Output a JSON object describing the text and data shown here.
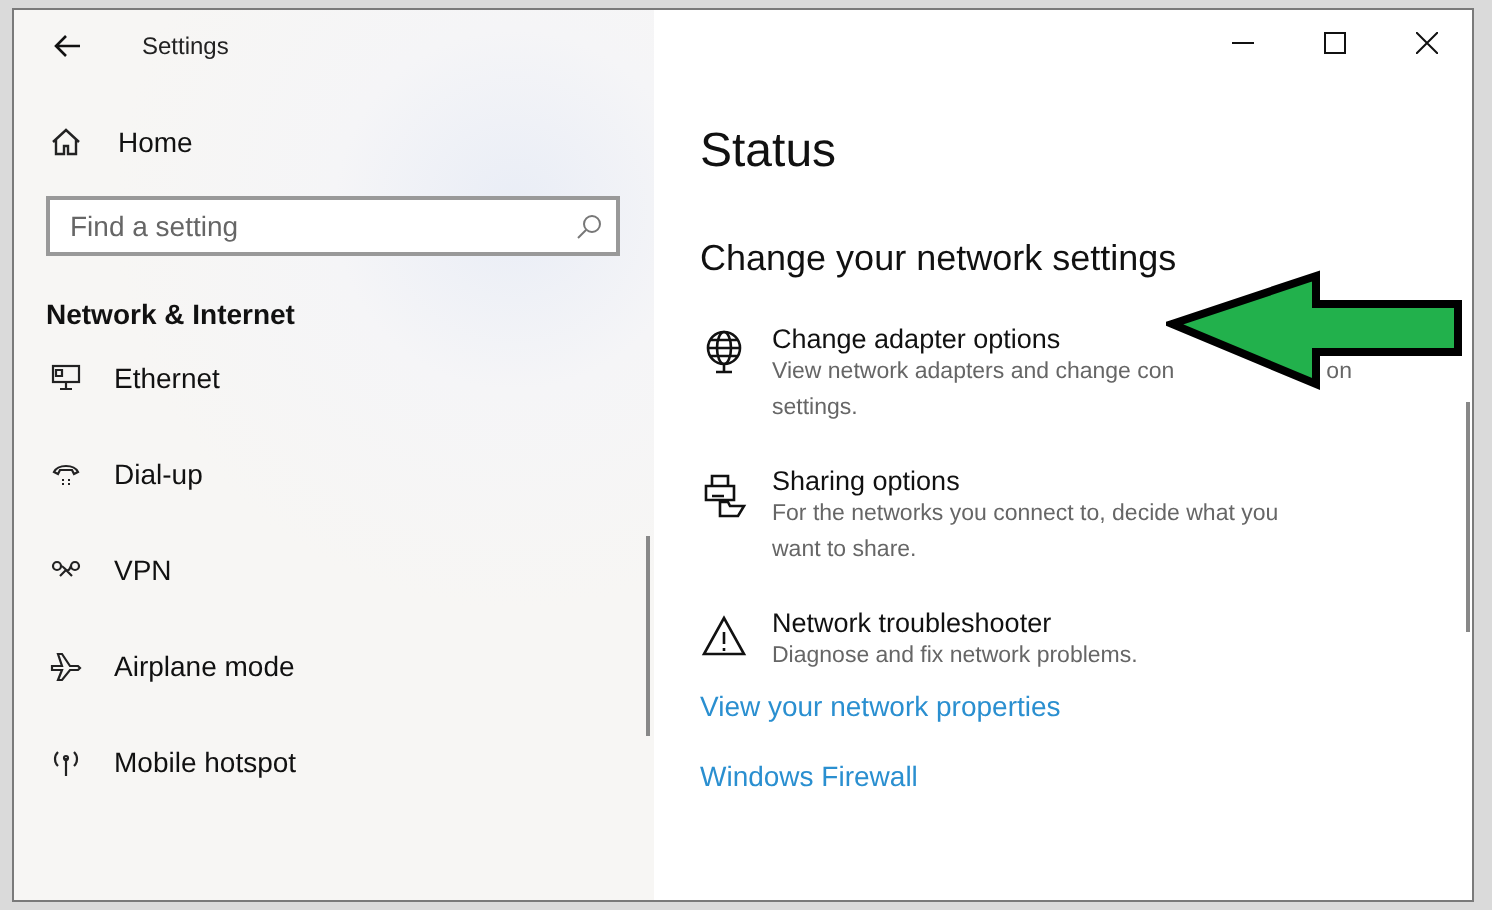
{
  "window": {
    "title": "Settings"
  },
  "sidebar": {
    "home": "Home",
    "search": {
      "placeholder": "Find a setting"
    },
    "section": "Network & Internet",
    "items": [
      {
        "label": "Ethernet",
        "kind": "ethernet"
      },
      {
        "label": "Dial-up",
        "kind": "dialup"
      },
      {
        "label": "VPN",
        "kind": "vpn"
      },
      {
        "label": "Airplane mode",
        "kind": "airplane"
      },
      {
        "label": "Mobile hotspot",
        "kind": "hotspot"
      }
    ]
  },
  "content": {
    "title": "Status",
    "subtitle": "Change your network settings",
    "options": [
      {
        "kind": "adapter",
        "title": "Change adapter options",
        "description_parts": [
          "View network adapters and change con",
          "on"
        ],
        "description_end": "settings."
      },
      {
        "kind": "sharing",
        "title": "Sharing options",
        "description_parts": [
          "For the networks you connect to, decide what you"
        ],
        "description_end": "want to share."
      },
      {
        "kind": "troubleshoot",
        "title": "Network troubleshooter",
        "description_parts": [
          "Diagnose and fix network problems."
        ]
      }
    ],
    "links": [
      "View your network properties",
      "Windows Firewall"
    ]
  },
  "annotation": {
    "kind": "arrow"
  }
}
